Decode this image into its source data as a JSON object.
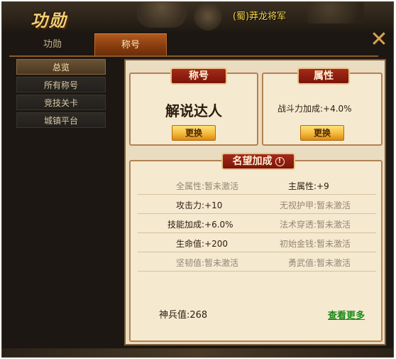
{
  "window": {
    "title": "功勋",
    "player_title": "(蜀)莽龙将军",
    "close_glyph": "✕"
  },
  "tabs": [
    {
      "label": "功勋",
      "active": false
    },
    {
      "label": "称号",
      "active": true
    }
  ],
  "sidebar": {
    "items": [
      {
        "label": "总览",
        "active": true
      },
      {
        "label": "所有称号",
        "active": false
      },
      {
        "label": "竞技关卡",
        "active": false
      },
      {
        "label": "城镇平台",
        "active": false
      }
    ]
  },
  "title_card": {
    "header": "称号",
    "name": "解说达人",
    "button": "更换"
  },
  "attr_card": {
    "header": "属性",
    "text": "战斗力加成:+4.0%",
    "button": "更换"
  },
  "prestige": {
    "header": "名望加成",
    "info_icon": "!",
    "rows": [
      {
        "left": {
          "label": "全属性",
          "value": "暂未激活",
          "active": false
        },
        "right": {
          "label": "主属性",
          "value": "+9",
          "active": true
        }
      },
      {
        "left": {
          "label": "攻击力",
          "value": "+10",
          "active": true
        },
        "right": {
          "label": "无视护甲",
          "value": "暂未激活",
          "active": false
        }
      },
      {
        "left": {
          "label": "技能加成",
          "value": "+6.0%",
          "active": true
        },
        "right": {
          "label": "法术穿透",
          "value": "暂未激活",
          "active": false
        }
      },
      {
        "left": {
          "label": "生命值",
          "value": "+200",
          "active": true
        },
        "right": {
          "label": "初始金钱",
          "value": "暂未激活",
          "active": false
        }
      },
      {
        "left": {
          "label": "坚韧值",
          "value": "暂未激活",
          "active": false
        },
        "right": {
          "label": "勇武值",
          "value": "暂未激活",
          "active": false
        }
      }
    ],
    "bing_value": "神兵值:268",
    "see_more": "查看更多"
  },
  "colors": {
    "accent_gold": "#f4b93a",
    "header_red": "#a52a1a",
    "link_green": "#1a8a1a",
    "inactive_gray": "#958775"
  }
}
